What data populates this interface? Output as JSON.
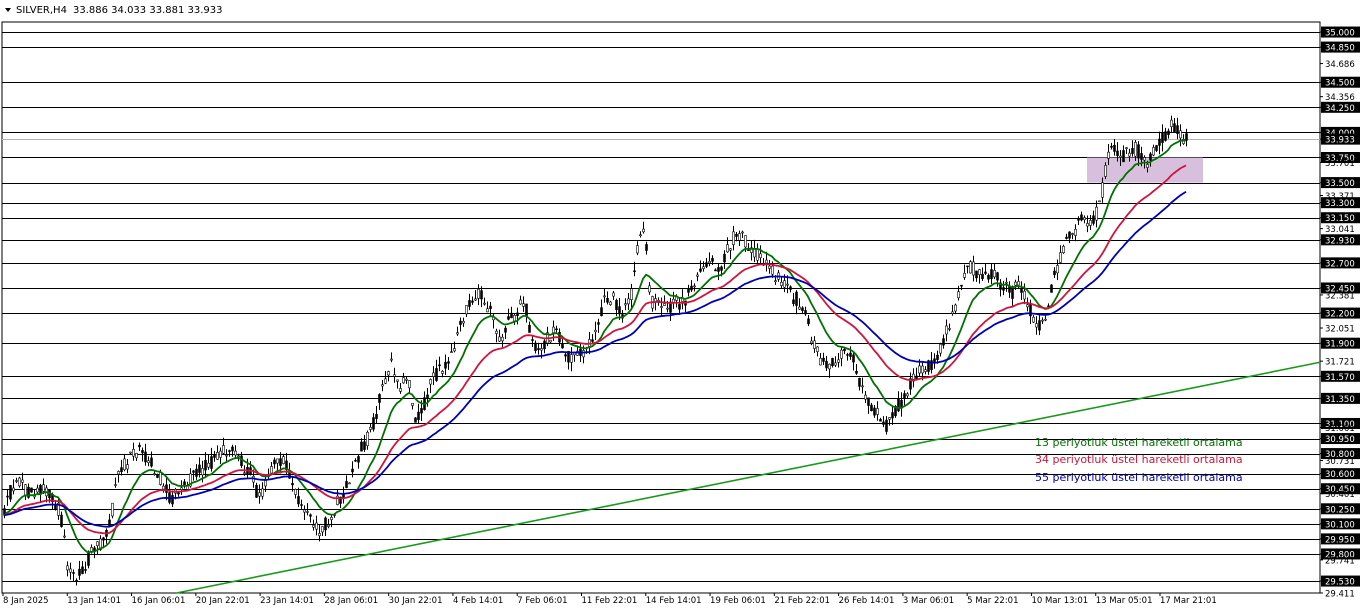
{
  "header": {
    "symbol": "SILVER,H4",
    "ohlc": "33.886 34.033 33.881 33.933"
  },
  "colors": {
    "ema13": "#007000",
    "ema34": "#d0143c",
    "ema55": "#0000b4",
    "trendline": "#1a9a1a",
    "zone": "#d2b4d8",
    "candle": "#000000"
  },
  "chart_data": {
    "type": "candlestick",
    "symbol": "SILVER",
    "timeframe": "H4",
    "ylim": [
      29.411,
      35.1
    ],
    "price_axis": [
      "35.000",
      "34.850",
      "34.686",
      "34.500",
      "34.356",
      "34.250",
      "34.000",
      "33.933",
      "33.750",
      "33.701",
      "33.500",
      "33.371",
      "33.300",
      "33.150",
      "33.041",
      "32.930",
      "32.700",
      "32.450",
      "32.381",
      "32.200",
      "32.051",
      "31.900",
      "31.721",
      "31.570",
      "31.350",
      "31.100",
      "31.061",
      "30.950",
      "30.800",
      "30.731",
      "30.600",
      "30.450",
      "30.401",
      "30.250",
      "30.100",
      "29.950",
      "29.800",
      "29.741",
      "29.530",
      "29.411"
    ],
    "highlighted_levels": [
      "35.000",
      "34.850",
      "34.500",
      "34.250",
      "34.000",
      "33.933",
      "33.750",
      "33.500",
      "33.300",
      "33.150",
      "32.930",
      "32.700",
      "32.450",
      "32.200",
      "31.900",
      "31.570",
      "31.350",
      "31.100",
      "30.950",
      "30.800",
      "30.600",
      "30.450",
      "30.250",
      "30.100",
      "29.950",
      "29.800",
      "29.530"
    ],
    "horizontal_levels": [
      35.0,
      34.85,
      34.5,
      34.25,
      34.0,
      33.75,
      33.5,
      33.3,
      33.15,
      32.93,
      32.7,
      32.45,
      32.2,
      31.9,
      31.57,
      31.35,
      31.1,
      30.95,
      30.8,
      30.6,
      30.45,
      30.25,
      30.1,
      29.95,
      29.8,
      29.53
    ],
    "current_price": 33.933,
    "x_labels": [
      "8 Jan 2025",
      "13 Jan 14:01",
      "16 Jan 06:01",
      "20 Jan 22:01",
      "23 Jan 14:01",
      "28 Jan 06:01",
      "30 Jan 22:01",
      "4 Feb 14:01",
      "7 Feb 06:01",
      "11 Feb 22:01",
      "14 Feb 14:01",
      "19 Feb 06:01",
      "21 Feb 22:01",
      "26 Feb 14:01",
      "3 Mar 06:01",
      "5 Mar 22:01",
      "10 Mar 13:01",
      "13 Mar 05:01",
      "17 Mar 21:01"
    ],
    "price_path": [
      [
        0,
        30.1
      ],
      [
        10,
        30.42
      ],
      [
        20,
        30.5
      ],
      [
        28,
        30.42
      ],
      [
        40,
        30.45
      ],
      [
        50,
        30.38
      ],
      [
        60,
        30.22
      ],
      [
        68,
        29.6
      ],
      [
        75,
        29.55
      ],
      [
        85,
        29.7
      ],
      [
        95,
        29.85
      ],
      [
        105,
        29.95
      ],
      [
        112,
        30.25
      ],
      [
        118,
        30.6
      ],
      [
        130,
        30.75
      ],
      [
        140,
        30.82
      ],
      [
        150,
        30.72
      ],
      [
        160,
        30.55
      ],
      [
        170,
        30.35
      ],
      [
        180,
        30.4
      ],
      [
        190,
        30.55
      ],
      [
        200,
        30.62
      ],
      [
        210,
        30.7
      ],
      [
        220,
        30.8
      ],
      [
        230,
        30.85
      ],
      [
        240,
        30.72
      ],
      [
        250,
        30.6
      ],
      [
        258,
        30.35
      ],
      [
        266,
        30.5
      ],
      [
        276,
        30.75
      ],
      [
        284,
        30.72
      ],
      [
        292,
        30.45
      ],
      [
        300,
        30.3
      ],
      [
        310,
        30.2
      ],
      [
        318,
        30.0
      ],
      [
        326,
        30.1
      ],
      [
        334,
        30.25
      ],
      [
        342,
        30.4
      ],
      [
        352,
        30.6
      ],
      [
        360,
        30.85
      ],
      [
        368,
        30.95
      ],
      [
        376,
        31.2
      ],
      [
        384,
        31.55
      ],
      [
        392,
        31.7
      ],
      [
        400,
        31.45
      ],
      [
        408,
        31.55
      ],
      [
        416,
        31.1
      ],
      [
        424,
        31.3
      ],
      [
        432,
        31.55
      ],
      [
        442,
        31.65
      ],
      [
        452,
        31.8
      ],
      [
        460,
        32.1
      ],
      [
        468,
        32.3
      ],
      [
        476,
        32.4
      ],
      [
        486,
        32.3
      ],
      [
        494,
        32.1
      ],
      [
        500,
        31.85
      ],
      [
        508,
        32.1
      ],
      [
        516,
        32.2
      ],
      [
        524,
        32.35
      ],
      [
        532,
        31.9
      ],
      [
        540,
        31.85
      ],
      [
        548,
        31.95
      ],
      [
        556,
        32.05
      ],
      [
        564,
        31.8
      ],
      [
        572,
        31.75
      ],
      [
        580,
        31.8
      ],
      [
        588,
        31.85
      ],
      [
        596,
        32.0
      ],
      [
        604,
        32.3
      ],
      [
        612,
        32.35
      ],
      [
        620,
        32.2
      ],
      [
        630,
        32.3
      ],
      [
        638,
        32.9
      ],
      [
        644,
        33.1
      ],
      [
        650,
        32.3
      ],
      [
        658,
        32.3
      ],
      [
        666,
        32.2
      ],
      [
        674,
        32.3
      ],
      [
        684,
        32.3
      ],
      [
        692,
        32.45
      ],
      [
        700,
        32.65
      ],
      [
        708,
        32.75
      ],
      [
        716,
        32.6
      ],
      [
        724,
        32.75
      ],
      [
        732,
        32.95
      ],
      [
        740,
        33.0
      ],
      [
        748,
        32.85
      ],
      [
        756,
        32.8
      ],
      [
        764,
        32.7
      ],
      [
        772,
        32.6
      ],
      [
        780,
        32.55
      ],
      [
        788,
        32.4
      ],
      [
        796,
        32.35
      ],
      [
        804,
        32.25
      ],
      [
        812,
        31.9
      ],
      [
        820,
        31.75
      ],
      [
        828,
        31.7
      ],
      [
        836,
        31.75
      ],
      [
        844,
        31.85
      ],
      [
        852,
        31.75
      ],
      [
        860,
        31.5
      ],
      [
        868,
        31.3
      ],
      [
        876,
        31.2
      ],
      [
        884,
        31.05
      ],
      [
        892,
        31.2
      ],
      [
        900,
        31.3
      ],
      [
        908,
        31.45
      ],
      [
        916,
        31.6
      ],
      [
        924,
        31.65
      ],
      [
        932,
        31.7
      ],
      [
        940,
        31.85
      ],
      [
        948,
        32.05
      ],
      [
        956,
        32.3
      ],
      [
        964,
        32.6
      ],
      [
        972,
        32.65
      ],
      [
        980,
        32.6
      ],
      [
        988,
        32.6
      ],
      [
        996,
        32.55
      ],
      [
        1004,
        32.45
      ],
      [
        1012,
        32.4
      ],
      [
        1020,
        32.5
      ],
      [
        1028,
        32.3
      ],
      [
        1036,
        32.05
      ],
      [
        1044,
        32.15
      ],
      [
        1052,
        32.5
      ],
      [
        1060,
        32.75
      ],
      [
        1068,
        32.95
      ],
      [
        1076,
        33.05
      ],
      [
        1084,
        33.15
      ],
      [
        1092,
        33.1
      ],
      [
        1100,
        33.3
      ],
      [
        1108,
        33.8
      ],
      [
        1116,
        33.85
      ],
      [
        1124,
        33.75
      ],
      [
        1132,
        33.85
      ],
      [
        1140,
        33.8
      ],
      [
        1148,
        33.7
      ],
      [
        1156,
        33.85
      ],
      [
        1164,
        33.95
      ],
      [
        1172,
        34.1
      ],
      [
        1180,
        33.95
      ],
      [
        1187,
        33.93
      ]
    ],
    "support_trendline": {
      "start_price": 29.41,
      "end_price": 31.71
    },
    "resistance_zone": {
      "top": 33.75,
      "bottom": 33.5
    },
    "series": [
      {
        "name": "13 periyotluk üstel hareketli ortalama",
        "type": "ema",
        "period": 13
      },
      {
        "name": "34 periyotluk üstel hareketli ortalama",
        "type": "ema",
        "period": 34
      },
      {
        "name": "55 periyotluk üstel hareketli ortalama",
        "type": "ema",
        "period": 55
      }
    ]
  }
}
